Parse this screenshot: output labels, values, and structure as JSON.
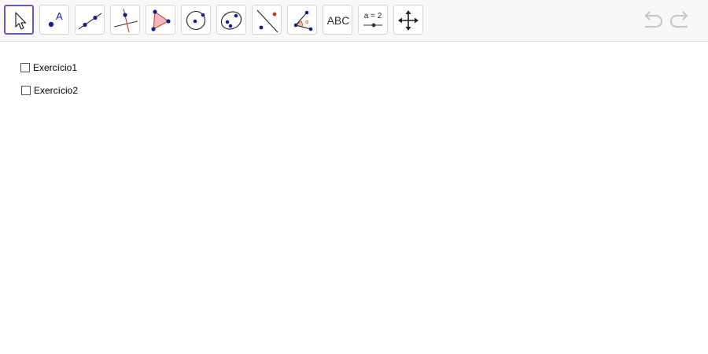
{
  "toolbar": {
    "tools": [
      {
        "name": "move-tool",
        "icon": "arrow-cursor-icon",
        "selected": true
      },
      {
        "name": "point-tool",
        "icon": "point-icon",
        "label": "A"
      },
      {
        "name": "line-tool",
        "icon": "line-through-points-icon"
      },
      {
        "name": "perpendicular-line-tool",
        "icon": "perpendicular-line-icon"
      },
      {
        "name": "polygon-tool",
        "icon": "polygon-icon"
      },
      {
        "name": "circle-center-point-tool",
        "icon": "circle-center-point-icon"
      },
      {
        "name": "ellipse-tool",
        "icon": "ellipse-icon"
      },
      {
        "name": "reflect-about-line-tool",
        "icon": "reflect-line-icon"
      },
      {
        "name": "angle-tool",
        "icon": "angle-icon",
        "label": "α"
      },
      {
        "name": "text-tool",
        "icon": "text-icon",
        "label": "ABC"
      },
      {
        "name": "slider-tool",
        "icon": "slider-icon",
        "label": "a = 2"
      },
      {
        "name": "move-graphics-view-tool",
        "icon": "move-arrows-icon"
      }
    ],
    "undo_icon": "undo-icon",
    "redo_icon": "redo-icon"
  },
  "canvas": {
    "checkboxes": [
      {
        "label": "Exercício1",
        "checked": false
      },
      {
        "label": "Exercício2",
        "checked": false
      }
    ]
  },
  "colors": {
    "selected_border": "#6557d2",
    "point_blue": "#1a1aa6",
    "polygon_fill": "#f2b8b8",
    "polygon_stroke": "#c0392b",
    "toolbar_bg": "#f8f8f8",
    "disabled_icon": "#c8c8c8"
  }
}
